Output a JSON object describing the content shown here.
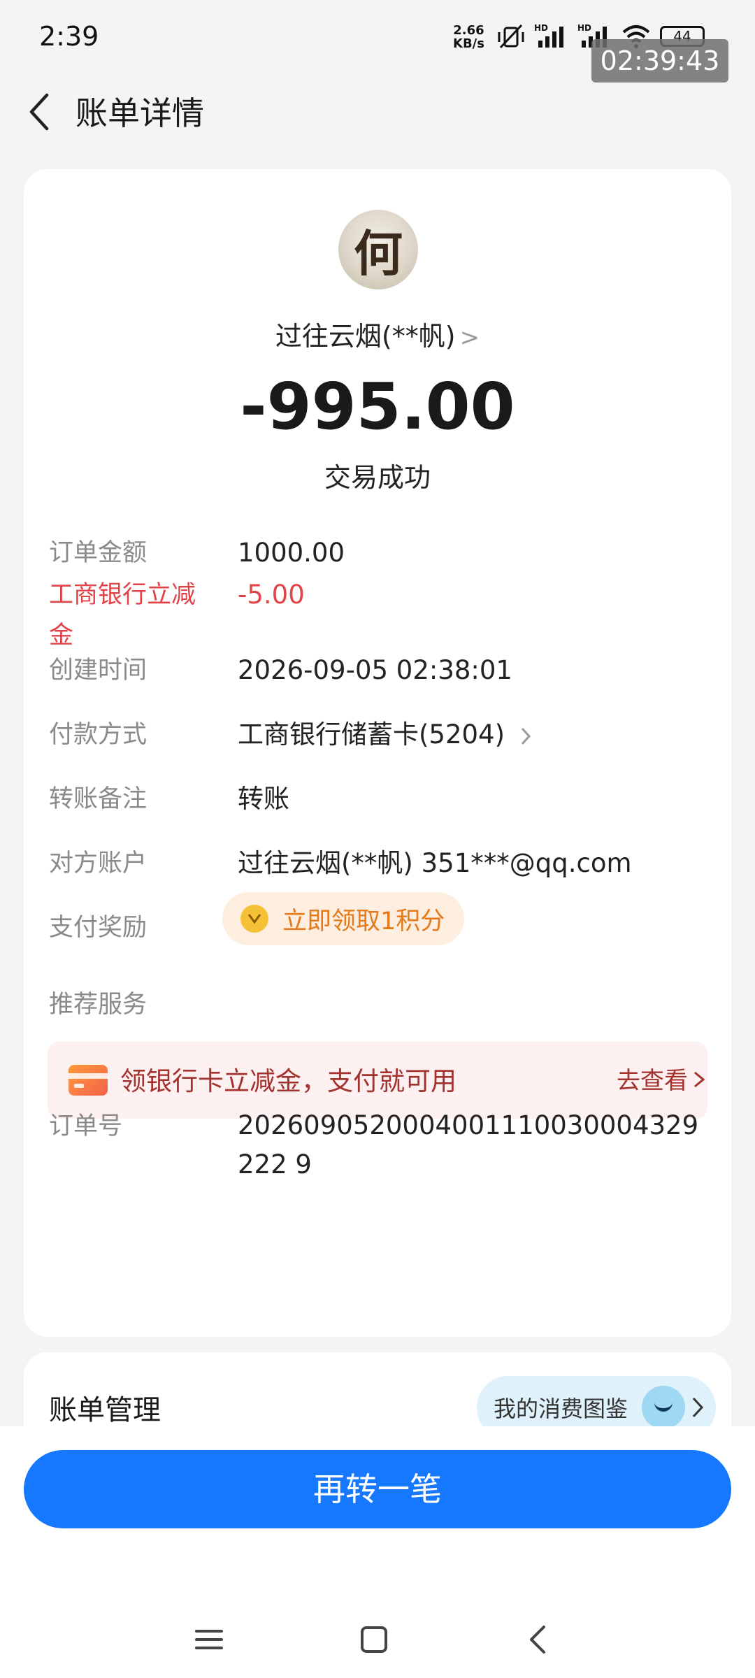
{
  "status_bar": {
    "time": "2:39",
    "net_speed_value": "2.66",
    "net_speed_unit": "KB/s",
    "battery": "44",
    "recording_clock": "02:39:43"
  },
  "header": {
    "title": "账单详情"
  },
  "transaction": {
    "payee": "过往云烟(**帆)",
    "amount": "-995.00",
    "status": "交易成功"
  },
  "details": {
    "order_amount_label": "订单金额",
    "order_amount_value": "1000.00",
    "discount_label": "工商银行立减金",
    "discount_value": "-5.00",
    "created_label": "创建时间",
    "created_value": "2026-09-05 02:38:01",
    "payment_label": "付款方式",
    "payment_value": "工商银行储蓄卡(5204)",
    "note_label": "转账备注",
    "note_value": "转账",
    "counterparty_label": "对方账户",
    "counterparty_value": "过往云烟(**帆) 351***@qq.com",
    "reward_label": "支付奖励",
    "reward_value": "立即领取1积分",
    "recommend_label": "推荐服务",
    "promo_text": "领银行卡立减金，支付就可用",
    "promo_link": "去查看",
    "order_no_label": "订单号",
    "order_no_value": "2026090520004001110030004329222 9"
  },
  "bill_management": {
    "title": "账单管理",
    "pill": "我的消费图鉴"
  },
  "cta": {
    "label": "再转一笔"
  },
  "colors": {
    "primary": "#1677ff",
    "discount_red": "#e04448",
    "reward_orange": "#e57a1a",
    "background": "#f4f4f4"
  },
  "icons": [
    "back-arrow-icon",
    "chevron-right-icon",
    "coin-icon",
    "bank-card-icon",
    "mascot-icon",
    "menu-icon",
    "home-icon",
    "nav-back-icon"
  ]
}
